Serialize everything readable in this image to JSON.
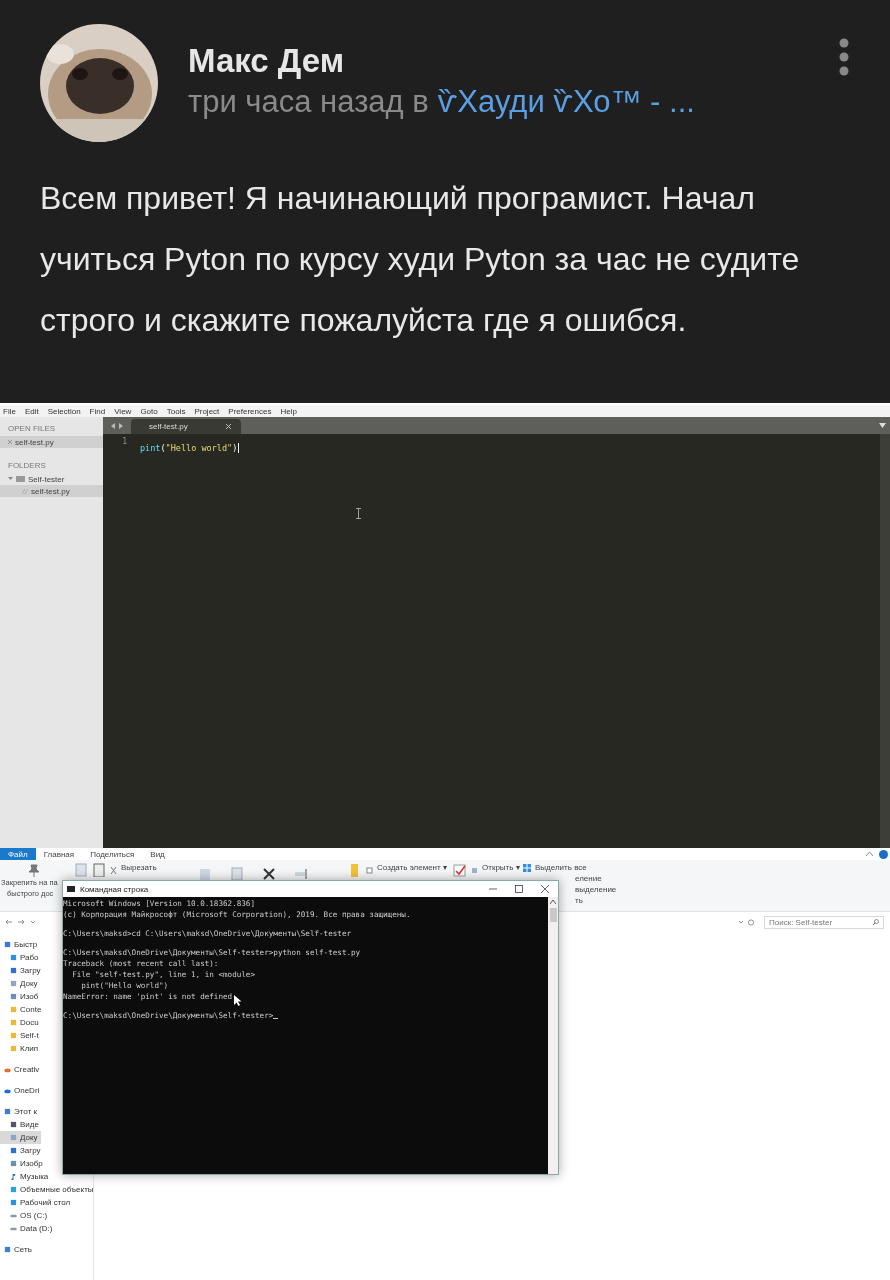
{
  "post": {
    "author": "Макс Дем",
    "time": "три часа назад в",
    "community": "ѷХауди ѷХо™ - ...",
    "text": "Всем привет! Я начинающий програмист. Начал учиться Pyton по курсу худи Pyton за час не судите строго и скажите пожалуйста где я ошибся."
  },
  "editor": {
    "menu": [
      "File",
      "Edit",
      "Selection",
      "Find",
      "View",
      "Goto",
      "Tools",
      "Project",
      "Preferences",
      "Help"
    ],
    "open_files_title": "OPEN FILES",
    "open_files": [
      {
        "name": "self-test.py",
        "selected": true
      }
    ],
    "folders_title": "FOLDERS",
    "folders": [
      {
        "name": "Self-tester",
        "expanded": true,
        "children": [
          {
            "name": "self-test.py",
            "selected": true
          }
        ]
      }
    ],
    "tab": {
      "label": "self-test.py"
    },
    "lines": [
      {
        "number": "1",
        "tokens": [
          {
            "text": "pint",
            "kind": "function"
          },
          {
            "text": "(",
            "kind": "punct"
          },
          {
            "text": "\"Hello world\"",
            "kind": "string"
          },
          {
            "text": ")",
            "kind": "punct"
          }
        ]
      }
    ]
  },
  "explorer": {
    "tabs": [
      {
        "label": "Файл",
        "selected": true
      },
      {
        "label": "Главная",
        "selected": false
      },
      {
        "label": "Поделиться",
        "selected": false
      },
      {
        "label": "Вид",
        "selected": false
      }
    ],
    "pin_label": [
      "Закрепить на па",
      "быстрого дос"
    ],
    "cut": "Вырезать",
    "new_item": "Создать элемент ▾",
    "open": "Открыть ▾",
    "select_all": "Выделить все",
    "select_rest": [
      "еление",
      "выделение",
      "ть"
    ],
    "search": {
      "placeholder": "Поиск: Self-tester"
    },
    "sidebar": [
      {
        "name": "Быстр",
        "kind": "star",
        "children": [
          {
            "name": "Рабо",
            "kind": "desktop",
            "selected": false
          },
          {
            "name": "Загру",
            "kind": "download",
            "selected": false
          },
          {
            "name": "Доку",
            "kind": "document",
            "selected": false
          },
          {
            "name": "Изоб",
            "selected": false
          },
          {
            "name": "Conte",
            "kind": "folder",
            "selected": false
          },
          {
            "name": "Docu",
            "kind": "folder",
            "selected": false
          },
          {
            "name": "Self-t",
            "kind": "folder",
            "selected": false
          },
          {
            "name": "Клип",
            "kind": "folder",
            "selected": false
          }
        ]
      },
      {
        "name": "Creativ",
        "kind": "cloud-orange"
      },
      {
        "name": "OneDri",
        "kind": "cloud"
      },
      {
        "name": "Этот к",
        "kind": "computer",
        "children": [
          {
            "name": "Виде",
            "kind": "video",
            "selected": false
          },
          {
            "name": "Доку",
            "kind": "document",
            "selected": true
          },
          {
            "name": "Загру",
            "kind": "download",
            "selected": false
          },
          {
            "name": "Изобр",
            "selected": false
          },
          {
            "name": "Музыка",
            "kind": "music",
            "selected": false
          },
          {
            "name": "Объемные объекты",
            "kind": "objects",
            "selected": false
          },
          {
            "name": "Рабочий стол",
            "kind": "desktop",
            "selected": false
          },
          {
            "name": "OS (C:)",
            "kind": "drive",
            "selected": false
          },
          {
            "name": "Data (D:)",
            "kind": "drive",
            "selected": false
          }
        ]
      },
      {
        "name": "Сеть",
        "kind": "network"
      }
    ]
  },
  "console": {
    "title": "Командная строка",
    "blocks": [
      [
        "Microsoft Windows [Version 10.0.18362.836]",
        "(c) Корпорация Майкрософт (Microsoft Corporation), 2019. Все права защищены."
      ],
      [
        "C:\\Users\\maksd>cd C:\\Users\\maksd\\OneDrive\\Документы\\Self-tester"
      ],
      [
        "C:\\Users\\maksd\\OneDrive\\Документы\\Self-tester>python self-test.py",
        "Traceback (most recent call last):",
        "  File \"self-test.py\", line 1, in <module>",
        "    pint(\"Hello world\")",
        "NameError: name 'pint' is not defined"
      ],
      [
        "C:\\Users\\maksd\\OneDrive\\Документы\\Self-tester>"
      ]
    ]
  }
}
